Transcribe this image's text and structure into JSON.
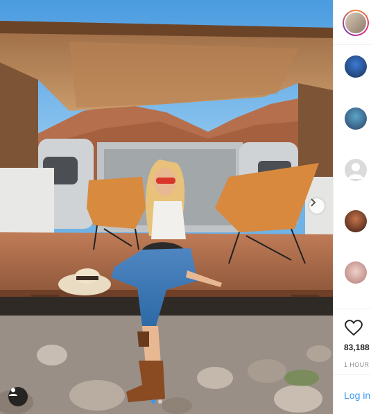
{
  "post": {
    "likes": "83,188",
    "time": "1 HOUR",
    "login_label": "Log in"
  },
  "sidebar": {
    "avatars": [
      "profile-avatar-story",
      "comment-avatar-1",
      "comment-avatar-2",
      "comment-avatar-placeholder",
      "comment-avatar-3",
      "comment-avatar-4"
    ]
  },
  "icons": {
    "like": "heart-icon",
    "next": "chevron-right-icon",
    "tags": "user-tag-icon"
  },
  "carousel": {
    "count": 2,
    "active_index": 0
  },
  "colors": {
    "accent": "#3897f0",
    "sky": "#6fb2e6",
    "deck": "#b06a45"
  }
}
